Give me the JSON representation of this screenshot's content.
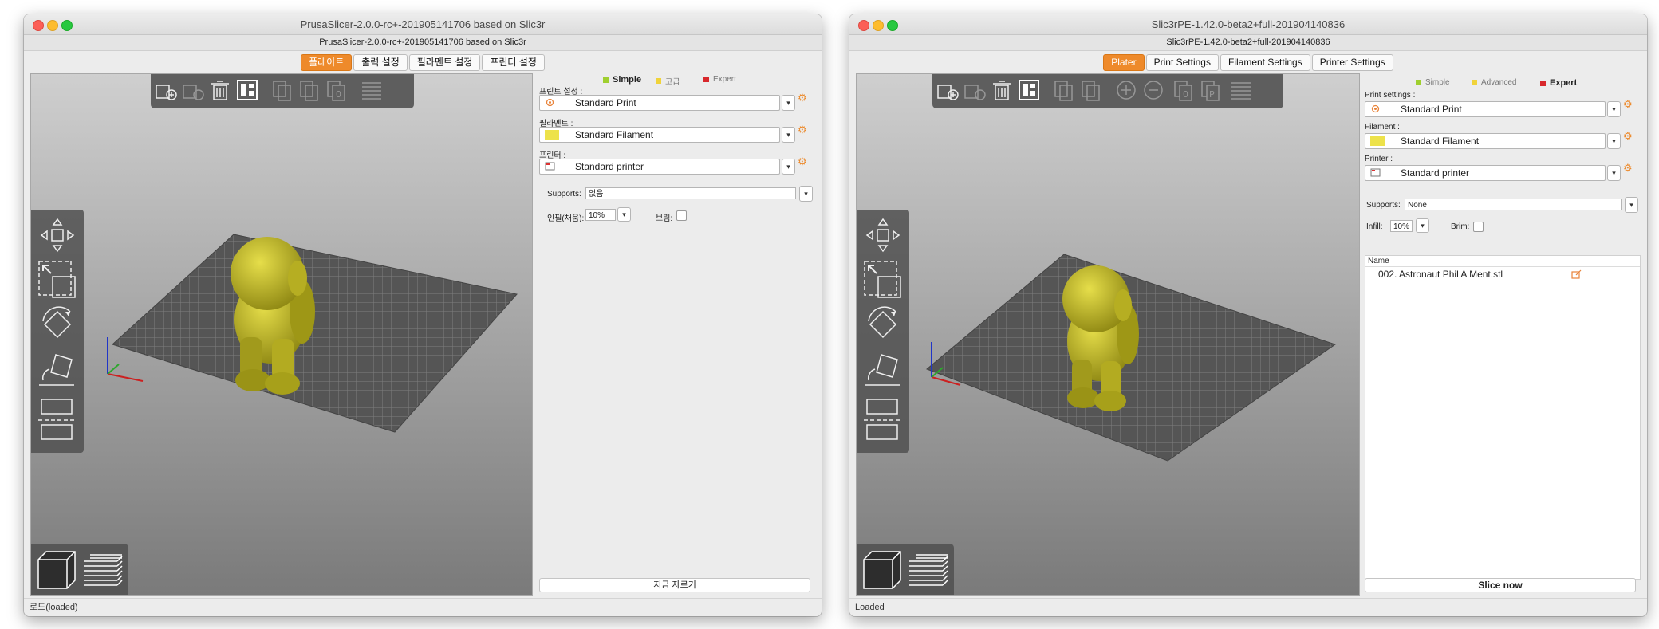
{
  "window1": {
    "title": "PrusaSlicer-2.0.0-rc+-201905141706 based on Slic3r",
    "subtitle": "PrusaSlicer-2.0.0-rc+-201905141706 based on Slic3r",
    "tabs": [
      "플레이트",
      "출력 설정",
      "필라멘트 설정",
      "프린터 설정"
    ],
    "active_tab": 0,
    "modes": {
      "simple": "Simple",
      "advanced": "고급",
      "expert": "Expert"
    },
    "print_settings_label": "프린트 설정 :",
    "print_settings_value": "Standard Print",
    "filament_label": "필라멘트 :",
    "filament_value": "Standard Filament",
    "printer_label": "프린터 :",
    "printer_value": "Standard printer",
    "supports_label": "Supports:",
    "supports_value": "없음",
    "infill_label": "인필(채움):",
    "infill_value": "10%",
    "brim_label": "브림:",
    "slice_button": "지금 자르기",
    "status": "로드(loaded)"
  },
  "window2": {
    "title": "Slic3rPE-1.42.0-beta2+full-201904140836",
    "subtitle": "Slic3rPE-1.42.0-beta2+full-201904140836",
    "tabs": [
      "Plater",
      "Print Settings",
      "Filament Settings",
      "Printer Settings"
    ],
    "active_tab": 0,
    "modes": {
      "simple": "Simple",
      "advanced": "Advanced",
      "expert": "Expert"
    },
    "print_settings_label": "Print settings :",
    "print_settings_value": "Standard Print",
    "filament_label": "Filament :",
    "filament_value": "Standard Filament",
    "printer_label": "Printer :",
    "printer_value": "Standard printer",
    "supports_label": "Supports:",
    "supports_value": "None",
    "infill_label": "Infill:",
    "infill_value": "10%",
    "brim_label": "Brim:",
    "object_list_header": "Name",
    "object_name": "002. Astronaut Phil A Ment.stl",
    "slice_button": "Slice now",
    "status": "Loaded"
  },
  "colors": {
    "accent_orange": "#ee8a2b",
    "model_yellow": "#c9c226",
    "mode_simple": "#9fcf2f",
    "mode_advanced": "#f0d33a",
    "mode_expert": "#d8282c",
    "filament_swatch": "#ede24a"
  },
  "icons": {
    "print_preset": "gear-icon",
    "filament_preset": "color-swatch-icon",
    "printer_preset": "printer-icon",
    "edit_preset": "gear-icon",
    "object_edit": "edit-icon"
  }
}
